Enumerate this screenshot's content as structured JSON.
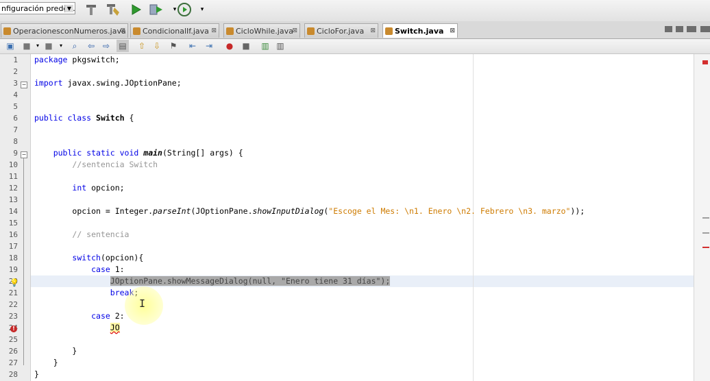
{
  "toolbar": {
    "config_value": "nfiguración prede...",
    "buttons": [
      "clean-build",
      "build",
      "run",
      "debug",
      "profile"
    ]
  },
  "tabs": [
    {
      "label": "OperacionesconNumeros.java",
      "active": false
    },
    {
      "label": "CondicionalIf.java",
      "active": false
    },
    {
      "label": "CicloWhile.java",
      "active": false
    },
    {
      "label": "CicloFor.java",
      "active": false
    },
    {
      "label": "Switch.java",
      "active": true
    }
  ],
  "line_numbers": [
    "1",
    "2",
    "3",
    "4",
    "5",
    "6",
    "7",
    "8",
    "9",
    "10",
    "11",
    "12",
    "13",
    "14",
    "15",
    "16",
    "17",
    "18",
    "19",
    "20",
    "21",
    "22",
    "23",
    "24",
    "25",
    "26",
    "27",
    "28"
  ],
  "code": {
    "l1_kw": "package",
    "l1_rest": " pkgswitch;",
    "l3_kw": "import",
    "l3_rest": " javax.swing.JOptionPane;",
    "l6_kw": "public class",
    "l6_name": "Switch",
    "l6_rest": " {",
    "l9_kw": "public static void",
    "l9_name": "main",
    "l9_rest": "(String[] args) {",
    "l10": "//sentencia Switch",
    "l12_kw": "int",
    "l12_rest": " opcion;",
    "l14_a": "opcion = Integer.",
    "l14_m1": "parseInt",
    "l14_b": "(JOptionPane.",
    "l14_m2": "showInputDialog",
    "l14_c": "(",
    "l14_str": "\"Escoge el Mes: \\n1. Enero \\n2. Febrero \\n3. marzo\"",
    "l14_d": "));",
    "l16": "// sentencia",
    "l18_kw": "switch",
    "l18_rest": "(opcion){",
    "l19_kw": "case",
    "l19_rest": " 1:",
    "l20": "JOptionPane.showMessageDialog(null, \"Enero tiene 31 días\");",
    "l21_kw": "break",
    "l21_rest": ";",
    "l23_kw": "case",
    "l23_rest": " 2:",
    "l24": "JO",
    "l26": "}",
    "l27": "}",
    "l28": "}"
  }
}
